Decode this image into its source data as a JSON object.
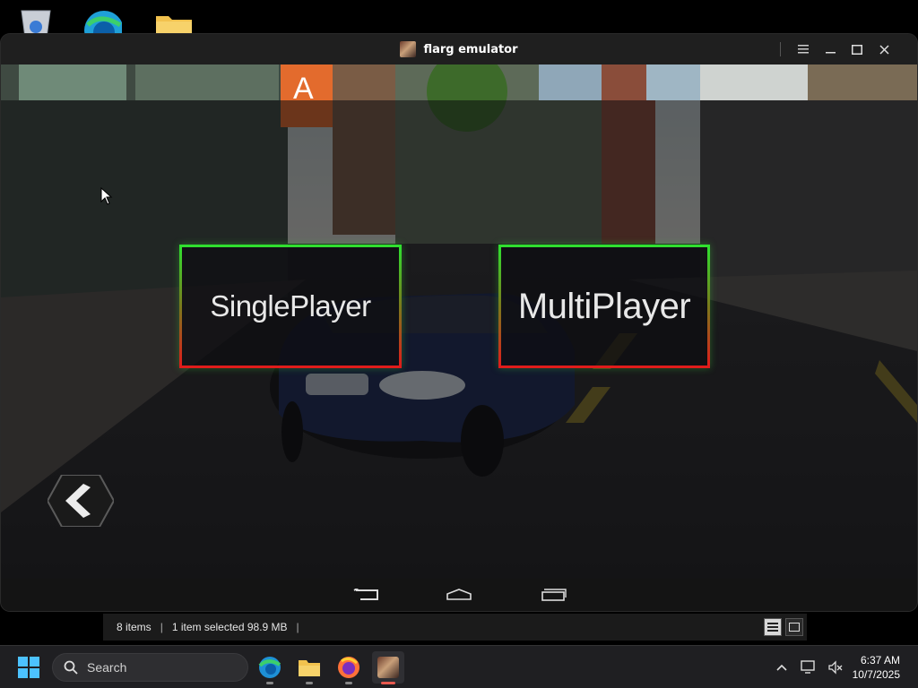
{
  "window": {
    "title": "flarg emulator"
  },
  "menu": {
    "single_player": "SinglePlayer",
    "multi_player": "MultiPlayer"
  },
  "explorer_status": {
    "items": "8 items",
    "selection": "1 item selected  98.9 MB"
  },
  "taskbar": {
    "search_label": "Search",
    "time": "6:37 AM",
    "date": "10/7/2025"
  },
  "colors": {
    "button_border_top": "#2fe02f",
    "button_border_bottom": "#e01b1b",
    "taskbar_bg": "#1f1f22",
    "active_app_indicator": "#e85a4f"
  }
}
